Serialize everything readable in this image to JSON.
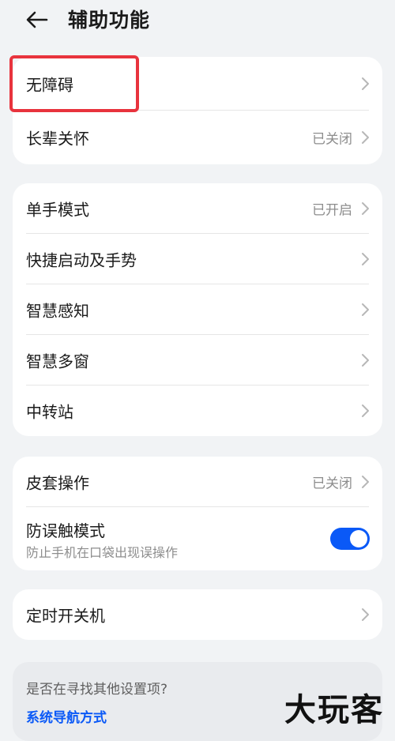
{
  "header": {
    "back_icon": "arrow-left-icon",
    "title": "辅助功能"
  },
  "group1": [
    {
      "label": "无障碍",
      "value": ""
    },
    {
      "label": "长辈关怀",
      "value": "已关闭"
    }
  ],
  "group2": [
    {
      "label": "单手模式",
      "value": "已开启"
    },
    {
      "label": "快捷启动及手势",
      "value": ""
    },
    {
      "label": "智慧感知",
      "value": ""
    },
    {
      "label": "智慧多窗",
      "value": ""
    },
    {
      "label": "中转站",
      "value": ""
    }
  ],
  "group3": {
    "cover": {
      "label": "皮套操作",
      "value": "已关闭"
    },
    "mistouch": {
      "label": "防误触模式",
      "subtitle": "防止手机在口袋出现误操作",
      "enabled": true
    }
  },
  "group4": [
    {
      "label": "定时开关机",
      "value": ""
    }
  ],
  "search": {
    "question": "是否在寻找其他设置项?",
    "link": "系统导航方式"
  },
  "watermark": "大玩客",
  "colors": {
    "accent": "#0a59f7",
    "highlight": "#e8333d",
    "background": "#f1f3f5",
    "card": "#ffffff"
  }
}
